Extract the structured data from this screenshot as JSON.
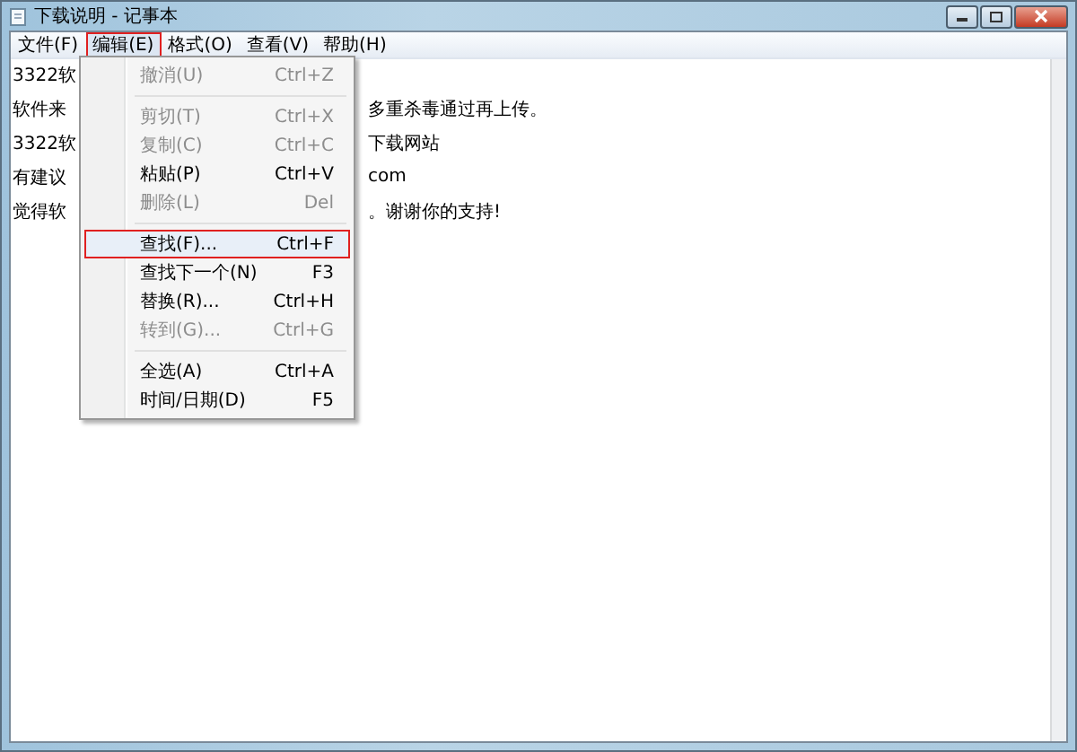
{
  "window": {
    "title": "下载说明 - 记事本"
  },
  "menu_bar": [
    {
      "label": "文件(F)",
      "selected": false
    },
    {
      "label": "编辑(E)",
      "selected": true
    },
    {
      "label": "格式(O)",
      "selected": false
    },
    {
      "label": "查看(V)",
      "selected": false
    },
    {
      "label": "帮助(H)",
      "selected": false
    }
  ],
  "edit_menu": [
    {
      "kind": "item",
      "label": "撤消(U)",
      "shortcut": "Ctrl+Z",
      "disabled": true,
      "selected": false
    },
    {
      "kind": "separator"
    },
    {
      "kind": "item",
      "label": "剪切(T)",
      "shortcut": "Ctrl+X",
      "disabled": true,
      "selected": false
    },
    {
      "kind": "item",
      "label": "复制(C)",
      "shortcut": "Ctrl+C",
      "disabled": true,
      "selected": false
    },
    {
      "kind": "item",
      "label": "粘贴(P)",
      "shortcut": "Ctrl+V",
      "disabled": false,
      "selected": false
    },
    {
      "kind": "item",
      "label": "删除(L)",
      "shortcut": "Del",
      "disabled": true,
      "selected": false
    },
    {
      "kind": "separator"
    },
    {
      "kind": "item",
      "label": "查找(F)...",
      "shortcut": "Ctrl+F",
      "disabled": false,
      "selected": true
    },
    {
      "kind": "item",
      "label": "查找下一个(N)",
      "shortcut": "F3",
      "disabled": false,
      "selected": false
    },
    {
      "kind": "item",
      "label": "替换(R)...",
      "shortcut": "Ctrl+H",
      "disabled": false,
      "selected": false
    },
    {
      "kind": "item",
      "label": "转到(G)...",
      "shortcut": "Ctrl+G",
      "disabled": true,
      "selected": false
    },
    {
      "kind": "separator"
    },
    {
      "kind": "item",
      "label": "全选(A)",
      "shortcut": "Ctrl+A",
      "disabled": false,
      "selected": false
    },
    {
      "kind": "item",
      "label": "时间/日期(D)",
      "shortcut": "F5",
      "disabled": false,
      "selected": false
    }
  ],
  "document_lines": [
    {
      "start": "3322软"
    },
    {
      "start": "软件来",
      "end": "多重杀毒通过再上传。"
    },
    {
      "start": "3322软",
      "end": "下载网站"
    },
    {
      "start": "有建议",
      "end": "com"
    },
    {
      "start": "觉得软",
      "end": "。谢谢你的支持!"
    }
  ]
}
